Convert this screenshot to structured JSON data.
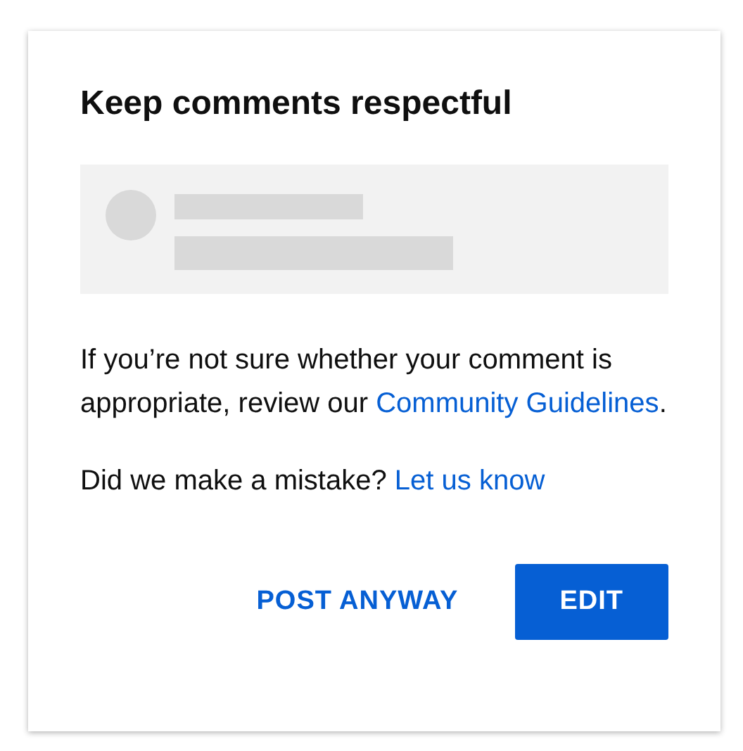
{
  "dialog": {
    "title": "Keep comments respectful",
    "paragraphs": [
      {
        "before": "If you’re not sure whether your comment is appropriate, review our ",
        "link": "Community Guidelines",
        "after": "."
      },
      {
        "before": "Did we make a mistake? ",
        "link": "Let us know"
      }
    ],
    "buttons": [
      {
        "label": "POST ANYWAY",
        "kind": "text"
      },
      {
        "label": "EDIT",
        "kind": "filled"
      }
    ]
  }
}
